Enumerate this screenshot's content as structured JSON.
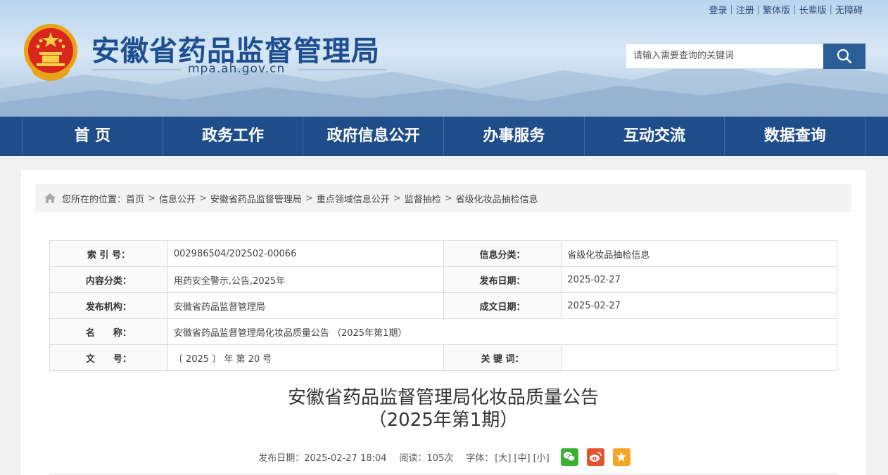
{
  "top_links": [
    "登录",
    "注册",
    "繁体版",
    "长辈版",
    "无障碍"
  ],
  "header": {
    "title": "安徽省药品监督管理局",
    "domain": "mpa.ah.gov.cn"
  },
  "search": {
    "placeholder": "请输入需要查询的关键词"
  },
  "nav": [
    "首 页",
    "政务工作",
    "政府信息公开",
    "办事服务",
    "互动交流",
    "数据查询"
  ],
  "breadcrumb": {
    "prefix": "您所在的位置：",
    "items": [
      "首页",
      "信息公开",
      "安徽省药品监督管理局",
      "重点领域信息公开",
      "监督抽检",
      "省级化妆品抽检信息"
    ]
  },
  "meta": {
    "index_label": "索 引 号：",
    "index_value": "002986504/202502-00066",
    "category_label": "信息分类：",
    "category_value": "省级化妆品抽检信息",
    "content_label": "内容分类：",
    "content_value": "用药安全警示,公告,2025年",
    "publish_label": "发布日期：",
    "publish_value": "2025-02-27",
    "org_label": "发布机构：",
    "org_value": "安徽省药品监督管理局",
    "created_label": "成文日期：",
    "created_value": "2025-02-27",
    "name_label": "名　　称：",
    "name_value": "安徽省药品监督管理局化妆品质量公告 （2025年第1期）",
    "docno_label": "文　　号：",
    "docno_value": "〔 2025 〕 年 第 20 号",
    "keywords_label": "关 键 词：",
    "keywords_value": ""
  },
  "article": {
    "title_line1": "安徽省药品监督管理局化妆品质量公告",
    "title_line2": "（2025年第1期）",
    "publish_date": "发布日期：2025-02-27 18:04",
    "reads": "阅读：105次",
    "font_label": "字体：",
    "font_large": "[大]",
    "font_medium": "[中]",
    "font_small": "[小]"
  },
  "colors": {
    "nav_bg": "#1e4d8a",
    "title": "#1d4e8f",
    "wechat": "#3cb034",
    "weibo": "#e6522c",
    "favorite": "#f5a623"
  }
}
